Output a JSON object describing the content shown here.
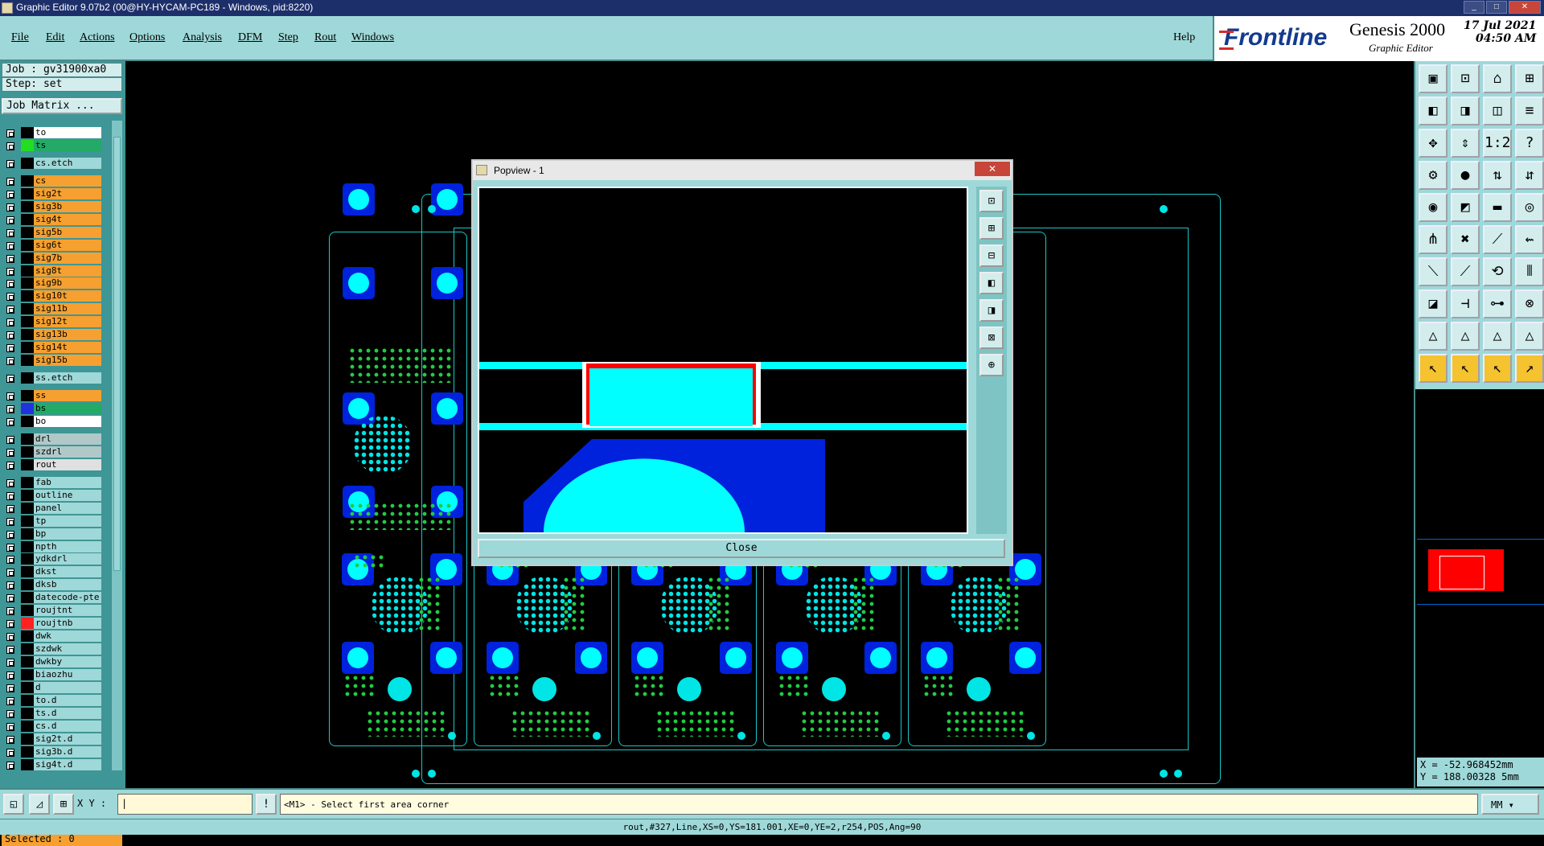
{
  "window": {
    "title": "Graphic Editor 9.07b2 (00@HY-HYCAM-PC189 - Windows, pid:8220)"
  },
  "menu": [
    "File",
    "Edit",
    "Actions",
    "Options",
    "Analysis",
    "DFM",
    "Step",
    "Rout",
    "Windows"
  ],
  "help": "Help",
  "brand": {
    "logo": "Frontline",
    "product": "Genesis 2000",
    "subtitle": "Graphic Editor",
    "date": "17 Jul 2021",
    "time": "04:50 AM"
  },
  "job": {
    "job_line": "Job : gv31900xa0",
    "step_line": "Step: set",
    "matrix_label": "Job Matrix ..."
  },
  "layers": [
    {
      "name": "to",
      "color": "#ffffff",
      "swatch": "#000000"
    },
    {
      "name": "ts",
      "color": "#22aa66",
      "swatch": "#22dd22"
    },
    {
      "name": "cs.etch",
      "color": "#9fd8d8",
      "swatch": "#000000"
    },
    {
      "name": "cs",
      "color": "#f5a030",
      "swatch": "#000000"
    },
    {
      "name": "sig2t",
      "color": "#f5a030",
      "swatch": "#000000"
    },
    {
      "name": "sig3b",
      "color": "#f5a030",
      "swatch": "#000000"
    },
    {
      "name": "sig4t",
      "color": "#f5a030",
      "swatch": "#000000"
    },
    {
      "name": "sig5b",
      "color": "#f5a030",
      "swatch": "#000000"
    },
    {
      "name": "sig6t",
      "color": "#f5a030",
      "swatch": "#000000"
    },
    {
      "name": "sig7b",
      "color": "#f5a030",
      "swatch": "#000000"
    },
    {
      "name": "sig8t",
      "color": "#f5a030",
      "swatch": "#000000"
    },
    {
      "name": "sig9b",
      "color": "#f5a030",
      "swatch": "#000000"
    },
    {
      "name": "sig10t",
      "color": "#f5a030",
      "swatch": "#000000"
    },
    {
      "name": "sig11b",
      "color": "#f5a030",
      "swatch": "#000000"
    },
    {
      "name": "sig12t",
      "color": "#f5a030",
      "swatch": "#000000"
    },
    {
      "name": "sig13b",
      "color": "#f5a030",
      "swatch": "#000000"
    },
    {
      "name": "sig14t",
      "color": "#f5a030",
      "swatch": "#000000"
    },
    {
      "name": "sig15b",
      "color": "#f5a030",
      "swatch": "#000000"
    },
    {
      "name": "ss.etch",
      "color": "#9fd8d8",
      "swatch": "#000000"
    },
    {
      "name": "ss",
      "color": "#f5a030",
      "swatch": "#000000"
    },
    {
      "name": "bs",
      "color": "#22aa66",
      "swatch": "#2233dd"
    },
    {
      "name": "bo",
      "color": "#ffffff",
      "swatch": "#000000"
    },
    {
      "name": "drl",
      "color": "#b0c8c8",
      "swatch": "#000000"
    },
    {
      "name": "szdrl",
      "color": "#b0c8c8",
      "swatch": "#000000"
    },
    {
      "name": "rout",
      "color": "#e0e0e0",
      "swatch": "#000000"
    },
    {
      "name": "fab",
      "color": "#9fd8d8",
      "swatch": "#000000"
    },
    {
      "name": "outline",
      "color": "#9fd8d8",
      "swatch": "#000000"
    },
    {
      "name": "panel",
      "color": "#9fd8d8",
      "swatch": "#000000"
    },
    {
      "name": "tp",
      "color": "#9fd8d8",
      "swatch": "#000000"
    },
    {
      "name": "bp",
      "color": "#9fd8d8",
      "swatch": "#000000"
    },
    {
      "name": "npth",
      "color": "#9fd8d8",
      "swatch": "#000000"
    },
    {
      "name": "ydkdrl",
      "color": "#9fd8d8",
      "swatch": "#000000"
    },
    {
      "name": "dkst",
      "color": "#9fd8d8",
      "swatch": "#000000"
    },
    {
      "name": "dksb",
      "color": "#9fd8d8",
      "swatch": "#000000"
    },
    {
      "name": "datecode-pte",
      "color": "#9fd8d8",
      "swatch": "#000000"
    },
    {
      "name": "roujtnt",
      "color": "#9fd8d8",
      "swatch": "#000000"
    },
    {
      "name": "roujtnb",
      "color": "#9fd8d8",
      "swatch": "#ff2222"
    },
    {
      "name": "dwk",
      "color": "#9fd8d8",
      "swatch": "#000000"
    },
    {
      "name": "szdwk",
      "color": "#9fd8d8",
      "swatch": "#000000"
    },
    {
      "name": "dwkby",
      "color": "#9fd8d8",
      "swatch": "#000000"
    },
    {
      "name": "biaozhu",
      "color": "#9fd8d8",
      "swatch": "#000000"
    },
    {
      "name": "d",
      "color": "#9fd8d8",
      "swatch": "#000000"
    },
    {
      "name": "to.d",
      "color": "#9fd8d8",
      "swatch": "#000000"
    },
    {
      "name": "ts.d",
      "color": "#9fd8d8",
      "swatch": "#000000"
    },
    {
      "name": "cs.d",
      "color": "#9fd8d8",
      "swatch": "#000000"
    },
    {
      "name": "sig2t.d",
      "color": "#9fd8d8",
      "swatch": "#000000"
    },
    {
      "name": "sig3b.d",
      "color": "#9fd8d8",
      "swatch": "#000000"
    },
    {
      "name": "sig4t.d",
      "color": "#9fd8d8",
      "swatch": "#000000"
    }
  ],
  "selected": "Selected : 0",
  "popview": {
    "title": "Popview - 1",
    "close_label": "Close"
  },
  "coords": {
    "x": "X = -52.968452mm",
    "y": "Y = 188.00328 5mm"
  },
  "bottom": {
    "xy_label": "X Y :",
    "message": "<M1> - Select first area corner",
    "units": "MM"
  },
  "status": "rout,#327,Line,XS=0,YS=181.001,XE=0,YE=2,r254,POS,Ang=90"
}
